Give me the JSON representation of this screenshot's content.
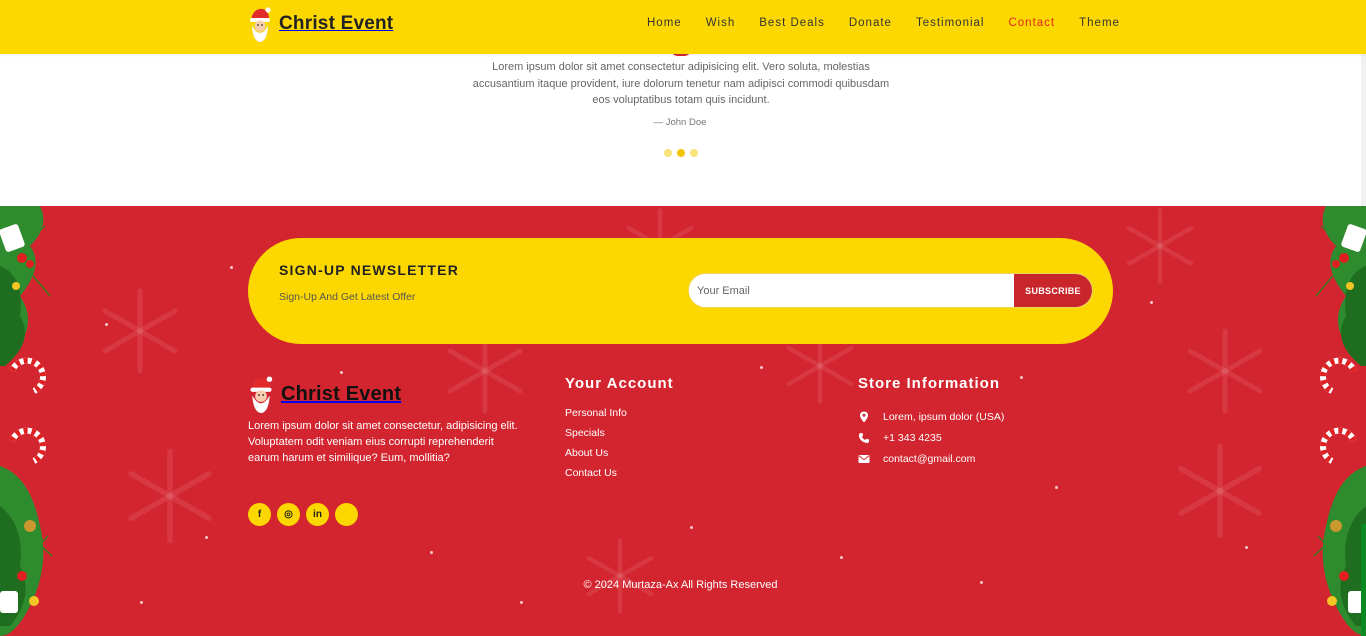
{
  "header": {
    "brand": "Christ Event",
    "nav": [
      "Home",
      "Wish",
      "Best Deals",
      "Donate",
      "Testimonial",
      "Contact",
      "Theme"
    ],
    "active_nav": "Contact"
  },
  "testimonial": {
    "quote": "Lorem ipsum dolor sit amet consectetur adipisicing elit. Vero soluta, molestias accusantium itaque provident, iure dolorum tenetur nam adipisci commodi quibusdam eos voluptatibus totam quis incidunt.",
    "author": "— John Doe",
    "active_slide": 2,
    "slide_count": 3
  },
  "newsletter": {
    "title": "SIGN-UP NEWSLETTER",
    "subtitle": "Sign-Up And Get Latest Offer",
    "email_placeholder": "Your Email",
    "button": "SUBSCRIBE"
  },
  "footer": {
    "brand": "Christ Event",
    "description": "Lorem ipsum dolor sit amet consectetur, adipisicing elit. Voluptatem odit veniam eius corrupti reprehenderit earum harum et similique? Eum, mollitia?",
    "socials": [
      {
        "icon": "facebook-icon",
        "glyph": "f"
      },
      {
        "icon": "instagram-icon",
        "glyph": "◎"
      },
      {
        "icon": "linkedin-icon",
        "glyph": "in"
      },
      {
        "icon": "blank-social-icon",
        "glyph": ""
      }
    ],
    "account": {
      "title": "Your Account",
      "links": [
        "Personal Info",
        "Specials",
        "About Us",
        "Contact Us"
      ]
    },
    "store": {
      "title": "Store Information",
      "address": "Lorem, ipsum dolor (USA)",
      "phone": "+1 343 4235",
      "email": "contact@gmail.com"
    },
    "copyright": "© 2024 Murtaza-Ax All Rights Reserved"
  },
  "colors": {
    "yellow": "#fcd800",
    "red": "#d3252f",
    "accent_red": "#e3281d",
    "button_red": "#c8262b"
  }
}
